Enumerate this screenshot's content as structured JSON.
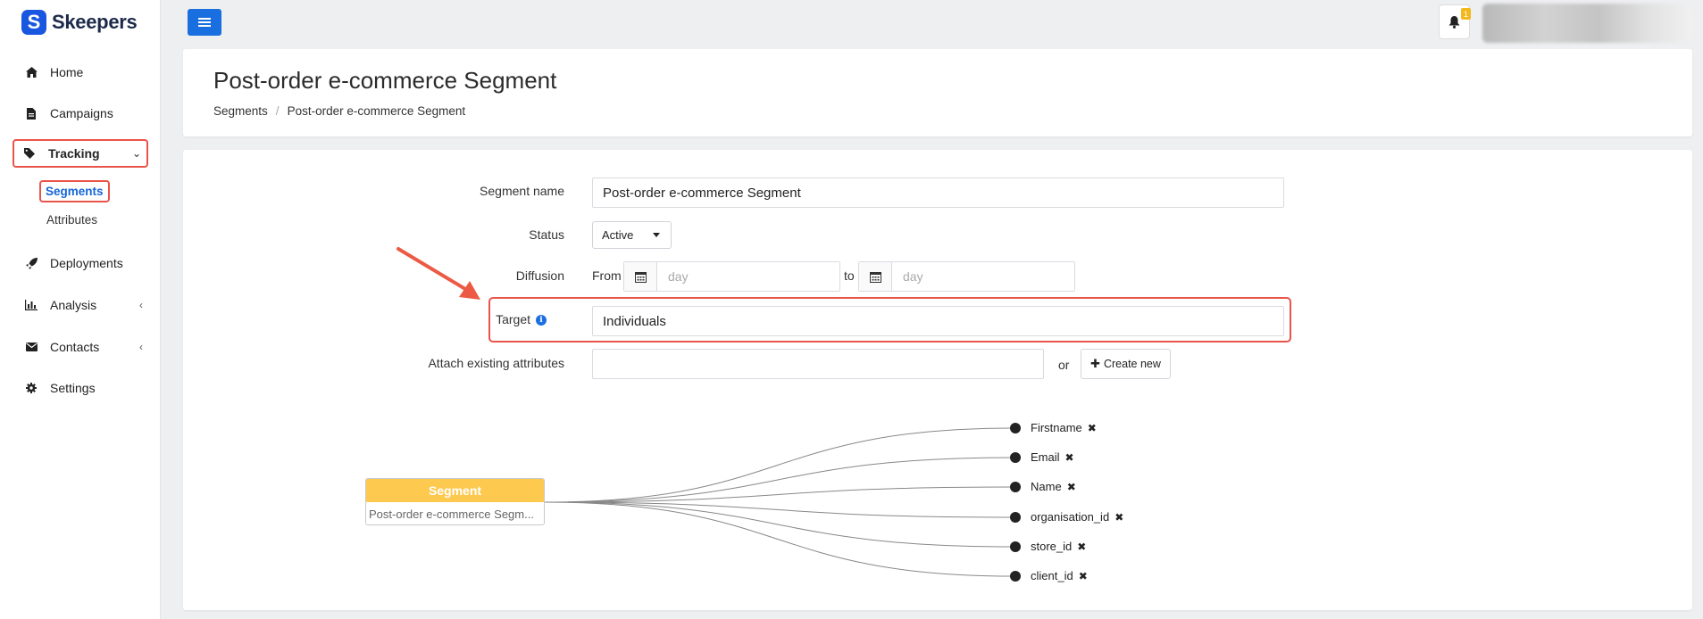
{
  "brand": {
    "name": "Skeepers",
    "mark": "S"
  },
  "sidebar": {
    "items": [
      {
        "label": "Home",
        "icon": "home-icon"
      },
      {
        "label": "Campaigns",
        "icon": "file-icon"
      },
      {
        "label": "Tracking",
        "icon": "tag-icon",
        "expanded": true
      },
      {
        "label": "Deployments",
        "icon": "rocket-icon"
      },
      {
        "label": "Analysis",
        "icon": "chart-icon"
      },
      {
        "label": "Contacts",
        "icon": "envelope-icon"
      },
      {
        "label": "Settings",
        "icon": "gear-icon"
      }
    ],
    "tracking_sub": [
      {
        "label": "Segments",
        "active": true
      },
      {
        "label": "Attributes"
      }
    ]
  },
  "topbar": {
    "notification_count": "1"
  },
  "header": {
    "title": "Post-order e-commerce Segment",
    "breadcrumb": [
      "Segments",
      "Post-order e-commerce Segment"
    ]
  },
  "form": {
    "segment_name_label": "Segment name",
    "segment_name_value": "Post-order e-commerce Segment",
    "status_label": "Status",
    "status_value": "Active",
    "diffusion_label": "Diffusion",
    "from_label": "From",
    "to_label": "to",
    "day_placeholder": "day",
    "target_label": "Target",
    "target_value": "Individuals",
    "attach_label": "Attach existing attributes",
    "or_label": "or",
    "create_new_label": "Create new"
  },
  "diagram": {
    "segment_header": "Segment",
    "segment_name": "Post-order e-commerce Segm...",
    "attributes": [
      "Firstname",
      "Email",
      "Name",
      "organisation_id",
      "store_id",
      "client_id"
    ]
  },
  "colors": {
    "primary": "#1a6fe0",
    "highlight": "#e9544a",
    "segment_header": "#fdc94f",
    "badge": "#f2b81c"
  }
}
